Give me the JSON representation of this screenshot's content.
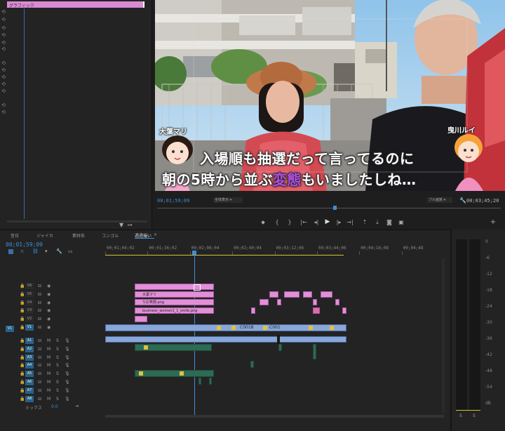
{
  "effect_controls": {
    "clip_label": "グラフィック"
  },
  "program_monitor": {
    "subtitle_line1": "入場順も抽選だって言ってるのに",
    "subtitle_line2_part1": "朝の5時から並ぶ",
    "subtitle_line2_highlight": "変態",
    "subtitle_line2_part2": "もいましたしね…",
    "name_left": "大葉マリ",
    "name_right": "曳川ルイ",
    "timecode_current": "00;01;59;09",
    "timecode_duration": "00;03;45;20",
    "zoom_select": "全体表示",
    "quality_select": "フル画質",
    "highlight_color": "#b04fe0"
  },
  "timeline": {
    "tabs": [
      "音日",
      "ジャイカ",
      "素材系",
      "コンゴル",
      "週週撮い"
    ],
    "active_tab_index": 4,
    "timecode": "00;01;59;09",
    "ruler_ticks": [
      "00;01;04;02",
      "00;01;36;02",
      "00;02;08;04",
      "00;02;40;04",
      "00;03;12;06",
      "00;03;44;06",
      "00;04;16;08",
      "00;04;48"
    ],
    "video_tracks": [
      "V6",
      "V5",
      "V4",
      "V3",
      "V2",
      "V1"
    ],
    "audio_tracks": [
      "A1",
      "A2",
      "A3",
      "A4",
      "A5",
      "A6",
      "A7",
      "A8"
    ],
    "source_patch_v": "V1",
    "mix_label": "ミックス",
    "mix_value": "0.0",
    "clips": {
      "v5_name": "大葉マリ",
      "v4_name": "りお笑顔.png",
      "v3_name": "business_woman1_1_smile.png",
      "v1_clip_a": "C0018",
      "v1_clip_b": "C001"
    }
  },
  "audio_meter": {
    "scale": [
      "0",
      "-6",
      "-12",
      "-18",
      "-24",
      "-30",
      "-36",
      "-42",
      "-48",
      "-54",
      "dB"
    ],
    "solo_labels": [
      "S",
      "S"
    ]
  }
}
